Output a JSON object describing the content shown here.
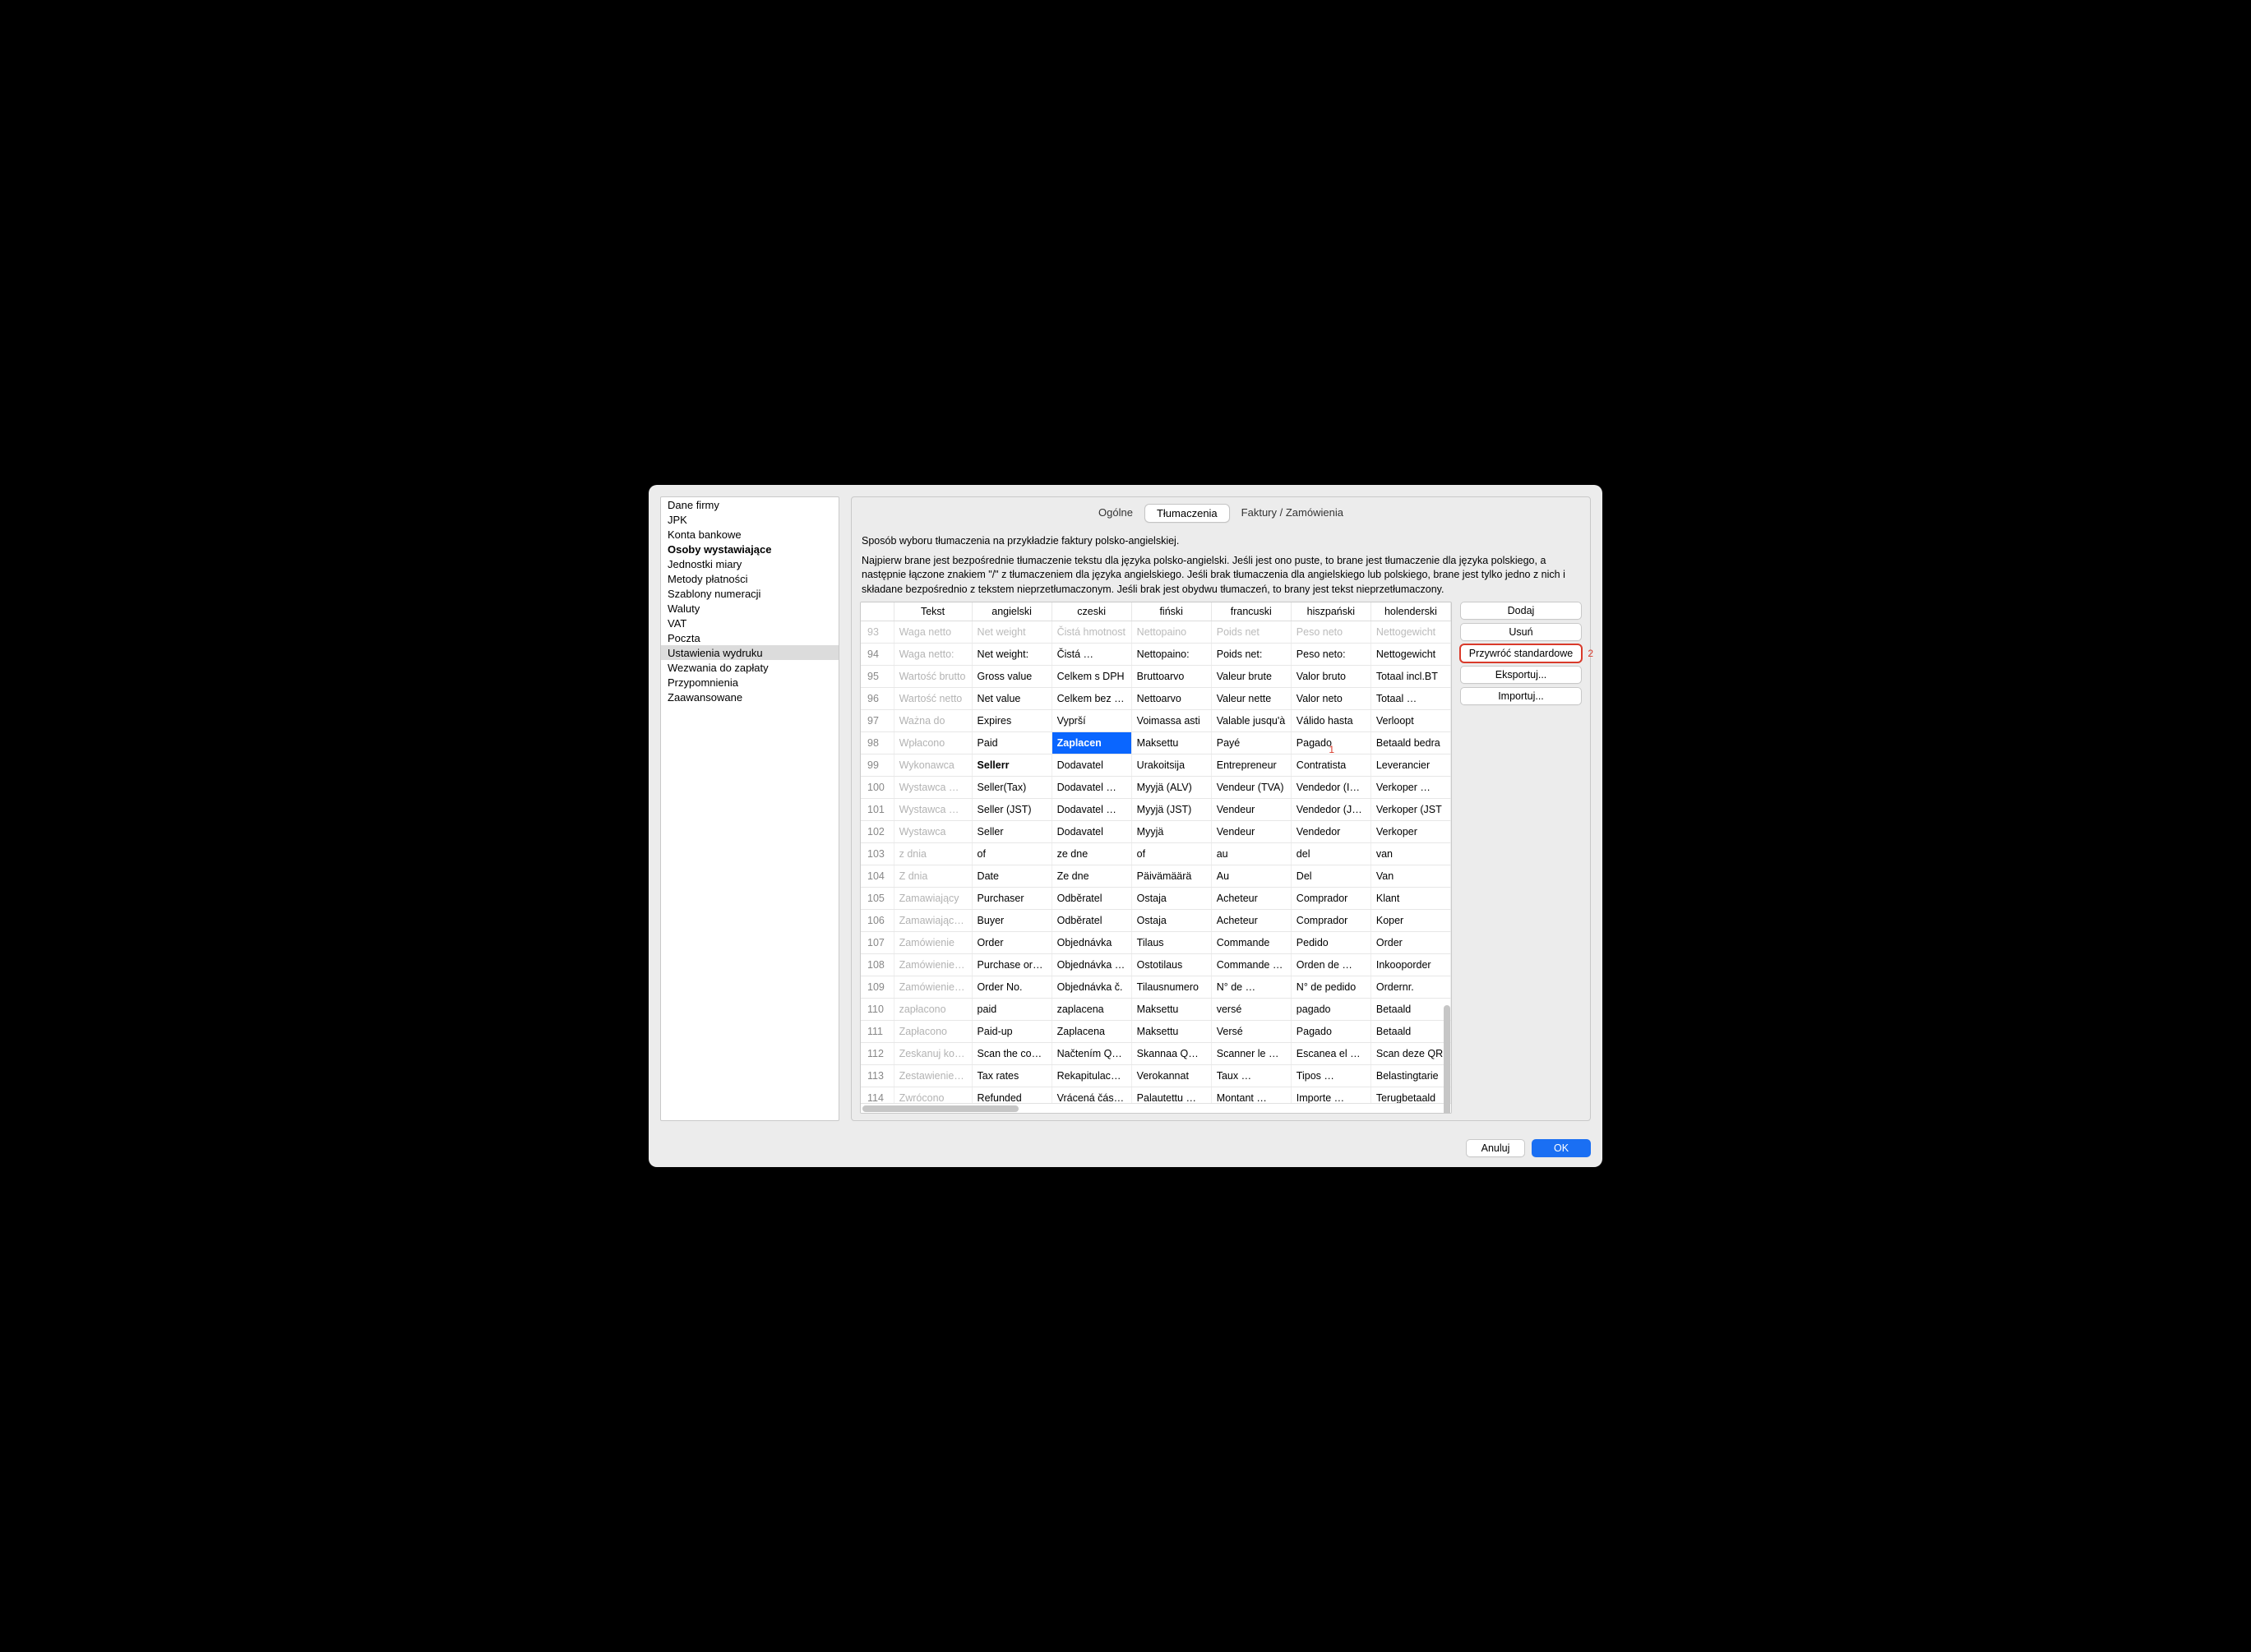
{
  "sidebar": {
    "items": [
      {
        "label": "Dane firmy",
        "bold": false
      },
      {
        "label": "JPK"
      },
      {
        "label": "Konta bankowe"
      },
      {
        "label": "Osoby wystawiające",
        "bold": true
      },
      {
        "label": "Jednostki miary"
      },
      {
        "label": "Metody płatności"
      },
      {
        "label": "Szablony numeracji"
      },
      {
        "label": "Waluty"
      },
      {
        "label": "VAT"
      },
      {
        "label": "Poczta"
      },
      {
        "label": "Ustawienia wydruku",
        "selected": true
      },
      {
        "label": "Wezwania do zapłaty"
      },
      {
        "label": "Przypomnienia"
      },
      {
        "label": "Zaawansowane"
      }
    ]
  },
  "tabs": {
    "items": [
      {
        "label": "Ogólne"
      },
      {
        "label": "Tłumaczenia",
        "active": true
      },
      {
        "label": "Faktury / Zamówienia"
      }
    ]
  },
  "description": {
    "line1": "Sposób wyboru tłumaczenia na przykładzie faktury polsko-angielskiej.",
    "line2": "Najpierw brane jest bezpośrednie tłumaczenie tekstu dla języka polsko-angielski. Jeśli jest ono puste, to brane jest tłumaczenie dla języka polskiego, a następnie łączone znakiem \"/\" z tłumaczeniem dla języka angielskiego. Jeśli brak tłumaczenia dla angielskiego lub polskiego, brane jest tylko jedno z nich i składane bezpośrednio z tekstem nieprzetłumaczonym. Jeśli brak jest obydwu tłumaczeń, to brany jest tekst nieprzetłumaczony."
  },
  "table": {
    "headers": [
      "",
      "Tekst",
      "angielski",
      "czeski",
      "fiński",
      "francuski",
      "hiszpański",
      "holenderski"
    ],
    "cutoff_row": {
      "idx": "93",
      "txt": "Waga netto",
      "cells": [
        "Net weight",
        "Čistá hmotnost",
        "Nettopaino",
        "Poids net",
        "Peso neto",
        "Nettogewicht"
      ]
    },
    "rows": [
      {
        "idx": "94",
        "txt": "Waga netto:",
        "cells": [
          "Net weight:",
          "Čistá …",
          "Nettopaino:",
          "Poids net:",
          "Peso neto:",
          "Nettogewicht"
        ]
      },
      {
        "idx": "95",
        "txt": "Wartość brutto",
        "cells": [
          "Gross value",
          "Celkem s DPH",
          "Bruttoarvo",
          "Valeur brute",
          "Valor bruto",
          "Totaal incl.BT"
        ]
      },
      {
        "idx": "96",
        "txt": "Wartość netto",
        "cells": [
          "Net value",
          "Celkem bez …",
          "Nettoarvo",
          "Valeur nette",
          "Valor neto",
          "Totaal …"
        ]
      },
      {
        "idx": "97",
        "txt": "Ważna do",
        "cells": [
          "Expires",
          "Vyprší",
          "Voimassa asti",
          "Valable jusqu'à",
          "Válido hasta",
          "Verloopt"
        ]
      },
      {
        "idx": "98",
        "txt": "Wpłacono",
        "cells": [
          "Paid",
          "Zaplacen",
          "Maksettu",
          "Payé",
          "Pagado",
          "Betaald bedra"
        ],
        "selected_col": 1
      },
      {
        "idx": "99",
        "txt": "Wykonawca",
        "cells": [
          "Sellerr",
          "Dodavatel",
          "Urakoitsija",
          "Entrepreneur",
          "Contratista",
          "Leverancier"
        ],
        "bold_col": 0
      },
      {
        "idx": "100",
        "txt": "Wystawca …",
        "cells": [
          "Seller(Tax)",
          "Dodavatel …",
          "Myyjä (ALV)",
          "Vendeur (TVA)",
          "Vendedor (IVA)",
          "Verkoper …"
        ]
      },
      {
        "idx": "101",
        "txt": "Wystawca …",
        "cells": [
          "Seller (JST)",
          "Dodavatel …",
          "Myyjä (JST)",
          "Vendeur",
          "Vendedor (JST)",
          "Verkoper (JST"
        ]
      },
      {
        "idx": "102",
        "txt": "Wystawca",
        "cells": [
          "Seller",
          "Dodavatel",
          "Myyjä",
          "Vendeur",
          "Vendedor",
          "Verkoper"
        ]
      },
      {
        "idx": "103",
        "txt": "z dnia",
        "cells": [
          "of",
          "ze dne",
          "of",
          "au",
          "del",
          "van"
        ]
      },
      {
        "idx": "104",
        "txt": "Z dnia",
        "cells": [
          "Date",
          "Ze dne",
          "Päivämäärä",
          "Au",
          "Del",
          "Van"
        ]
      },
      {
        "idx": "105",
        "txt": "Zamawiający",
        "cells": [
          "Purchaser",
          "Odběratel",
          "Ostaja",
          "Acheteur",
          "Comprador",
          "Klant"
        ]
      },
      {
        "idx": "106",
        "txt": "Zamawiający …",
        "cells": [
          "Buyer",
          "Odběratel",
          "Ostaja",
          "Acheteur",
          "Comprador",
          "Koper"
        ]
      },
      {
        "idx": "107",
        "txt": "Zamówienie",
        "cells": [
          "Order",
          "Objednávka",
          "Tilaus",
          "Commande",
          "Pedido",
          "Order"
        ]
      },
      {
        "idx": "108",
        "txt": "Zamówienie d…",
        "cells": [
          "Purchase order",
          "Objednávka …",
          "Ostotilaus",
          "Commande …",
          "Orden de …",
          "Inkooporder"
        ]
      },
      {
        "idx": "109",
        "txt": "Zamówienie nr",
        "cells": [
          "Order No.",
          "Objednávka č.",
          "Tilausnumero",
          "N° de …",
          "N° de pedido",
          "Ordernr."
        ]
      },
      {
        "idx": "110",
        "txt": "zapłacono",
        "cells": [
          "paid",
          "zaplacena",
          "Maksettu",
          "versé",
          "pagado",
          "Betaald"
        ]
      },
      {
        "idx": "111",
        "txt": "Zapłacono",
        "cells": [
          "Paid-up",
          "Zaplacena",
          "Maksettu",
          "Versé",
          "Pagado",
          "Betaald"
        ]
      },
      {
        "idx": "112",
        "txt": "Zeskanuj kod …",
        "cells": [
          "Scan the cod…",
          "Načtením QR …",
          "Skannaa QR-…",
          "Scanner le …",
          "Escanea el …",
          "Scan deze QR"
        ]
      },
      {
        "idx": "113",
        "txt": "Zestawienie …",
        "cells": [
          "Tax rates",
          "Rekapitulace …",
          "Verokannat",
          "Taux …",
          "Tipos …",
          "Belastingtarie"
        ]
      },
      {
        "idx": "114",
        "txt": "Zwrócono",
        "cells": [
          "Refunded",
          "Vrácená částka",
          "Palautettu …",
          "Montant …",
          "Importe …",
          "Terugbetaald"
        ]
      }
    ]
  },
  "right_buttons": {
    "add": "Dodaj",
    "remove": "Usuń",
    "restore": "Przywróć standardowe",
    "export": "Eksportuj...",
    "import": "Importuj..."
  },
  "annotations": {
    "a1": "1",
    "a2": "2"
  },
  "footer": {
    "cancel": "Anuluj",
    "ok": "OK"
  }
}
